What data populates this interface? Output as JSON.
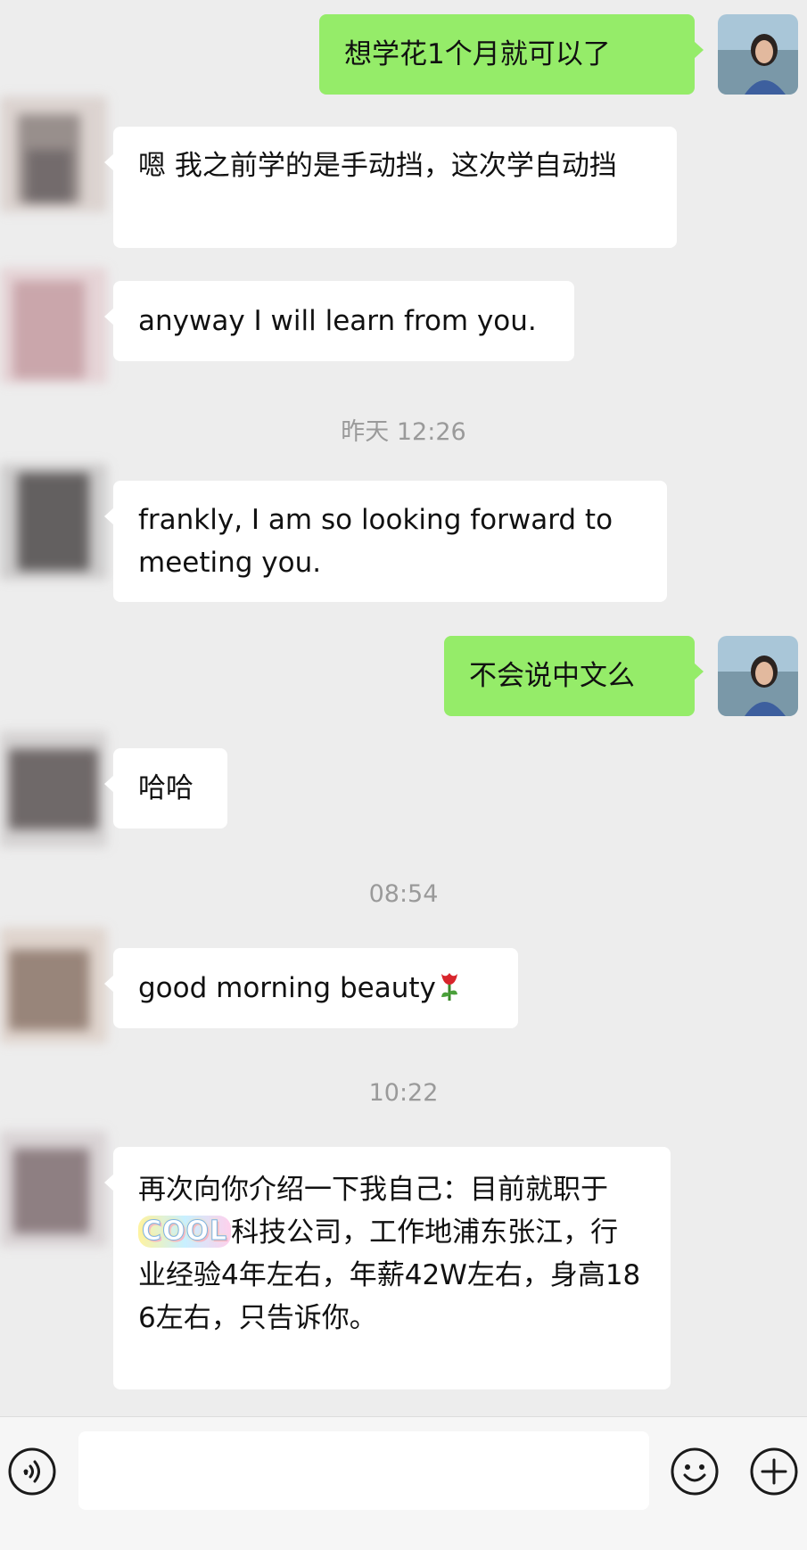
{
  "messages": [
    {
      "side": "right",
      "text": "想学花1个月就可以了"
    },
    {
      "side": "left",
      "text": "嗯 我之前学的是手动挡，这次学自动挡"
    },
    {
      "side": "left",
      "text": "anyway I will learn from you."
    },
    {
      "timestamp": "昨天 12:26"
    },
    {
      "side": "left",
      "text": "frankly, I am so looking forward to meeting you."
    },
    {
      "side": "right",
      "text": "不会说中文么"
    },
    {
      "side": "left",
      "text": "哈哈"
    },
    {
      "timestamp": "08:54"
    },
    {
      "side": "left",
      "text": "good morning beauty"
    },
    {
      "timestamp": "10:22"
    },
    {
      "side": "left",
      "text_before": "再次向你介绍一下我自己：目前就职于",
      "sticker": "COOL",
      "text_after": "科技公司，工作地浦东张江，行业经验4年左右，年薪42W左右，身高186左右，只告诉你。"
    }
  ],
  "m1": {
    "text": "想学花1个月就可以了"
  },
  "m2": {
    "text": "嗯 我之前学的是手动挡，这次学自动挡"
  },
  "m3": {
    "text": "anyway I will learn from you."
  },
  "t1": {
    "text": "昨天 12:26"
  },
  "m4": {
    "text": "frankly, I am so looking forward to meeting you."
  },
  "m5": {
    "text": "不会说中文么"
  },
  "m6": {
    "text": "哈哈"
  },
  "t2": {
    "text": "08:54"
  },
  "m7": {
    "text": "good morning beauty"
  },
  "t3": {
    "text": "10:22"
  },
  "m8": {
    "before": "再次向你介绍一下我自己：目前就职于",
    "sticker": "COOL",
    "after": "科技公司，工作地浦东张江，行业经验4年左右，年薪42W左右，身高186左右，只告诉你。"
  },
  "input": {
    "value": "",
    "placeholder": ""
  },
  "icons": {
    "voice": "voice-icon",
    "emoji": "emoji-icon",
    "more": "plus-icon",
    "rose": "rose-icon"
  },
  "colors": {
    "background": "#ededed",
    "sent_bubble": "#95ec69",
    "received_bubble": "#ffffff",
    "timestamp": "#9a9a9a",
    "input_bar": "#f6f6f6"
  }
}
